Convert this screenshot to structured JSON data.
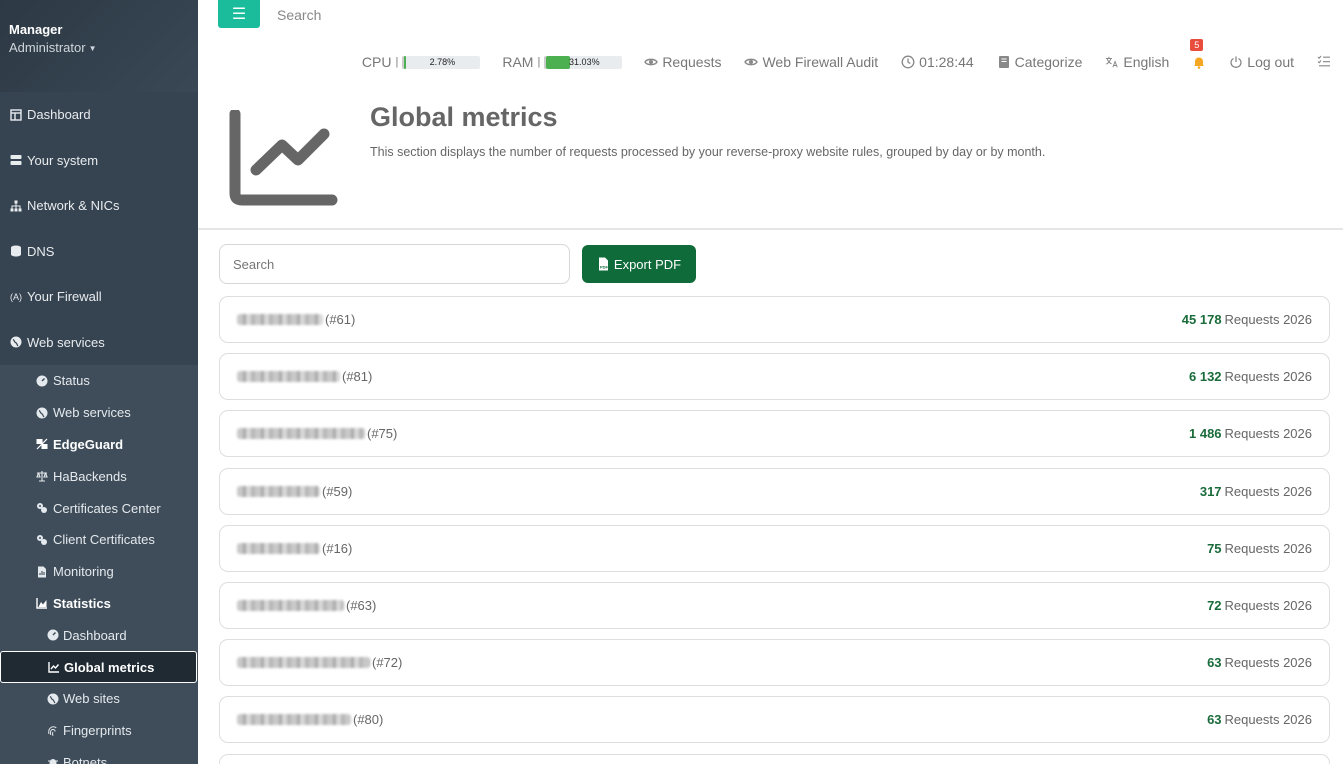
{
  "sidebar": {
    "user": "Manager",
    "role": "Administrator",
    "items": [
      {
        "label": "Dashboard",
        "icon": "layout-icon"
      },
      {
        "label": "Your system",
        "icon": "server-icon"
      },
      {
        "label": "Network & NICs",
        "icon": "network-icon"
      },
      {
        "label": "DNS",
        "icon": "database-icon"
      },
      {
        "label": "Your Firewall",
        "icon": "firewall-icon"
      },
      {
        "label": "Web services",
        "icon": "globe-icon"
      }
    ],
    "sub_items": [
      {
        "label": "Status",
        "icon": "gauge-icon"
      },
      {
        "label": "Web services",
        "icon": "globe-icon"
      },
      {
        "label": "EdgeGuard",
        "icon": "edgeguard-icon"
      },
      {
        "label": "HaBackends",
        "icon": "balance-icon"
      },
      {
        "label": "Certificates Center",
        "icon": "certificate-icon"
      },
      {
        "label": "Client Certificates",
        "icon": "certificate-icon"
      },
      {
        "label": "Monitoring",
        "icon": "file-chart-icon"
      },
      {
        "label": "Statistics",
        "icon": "chart-area-icon"
      }
    ],
    "stats_items": [
      {
        "label": "Dashboard",
        "icon": "gauge-icon"
      },
      {
        "label": "Global metrics",
        "icon": "chart-line-icon"
      },
      {
        "label": "Web sites",
        "icon": "globe-icon"
      },
      {
        "label": "Fingerprints",
        "icon": "fingerprint-icon"
      },
      {
        "label": "Botnets",
        "icon": "bug-icon"
      }
    ]
  },
  "topbar": {
    "search_placeholder": "Search",
    "cpu_label": "CPU",
    "cpu_value": "2.78%",
    "cpu_fraction": 0.0278,
    "ram_label": "RAM",
    "ram_value": "31.03%",
    "ram_fraction": 0.3103,
    "requests": "Requests",
    "audit": "Web Firewall Audit",
    "clock": "01:28:44",
    "categorize": "Categorize",
    "language": "English",
    "notifications": "5",
    "logout": "Log out"
  },
  "header": {
    "title": "Global metrics",
    "description": "This section displays the number of requests processed by your reverse-proxy website rules, grouped by day or by month."
  },
  "toolbar": {
    "search_placeholder": "Search",
    "export_label": "Export PDF"
  },
  "rows": [
    {
      "id": "(#61)",
      "count": "45 178",
      "suffix": "Requests 2026"
    },
    {
      "id": "(#81)",
      "count": "6 132",
      "suffix": "Requests 2026"
    },
    {
      "id": "(#75)",
      "count": "1 486",
      "suffix": "Requests 2026"
    },
    {
      "id": "(#59)",
      "count": "317",
      "suffix": "Requests 2026"
    },
    {
      "id": "(#16)",
      "count": "75",
      "suffix": "Requests 2026"
    },
    {
      "id": "(#63)",
      "count": "72",
      "suffix": "Requests 2026"
    },
    {
      "id": "(#72)",
      "count": "63",
      "suffix": "Requests 2026"
    },
    {
      "id": "(#80)",
      "count": "63",
      "suffix": "Requests 2026"
    }
  ],
  "colors": {
    "accent": "#1abc9c",
    "export": "#0f6b3a",
    "count": "#1a6b3a",
    "sidebar": "#3c4a57"
  }
}
